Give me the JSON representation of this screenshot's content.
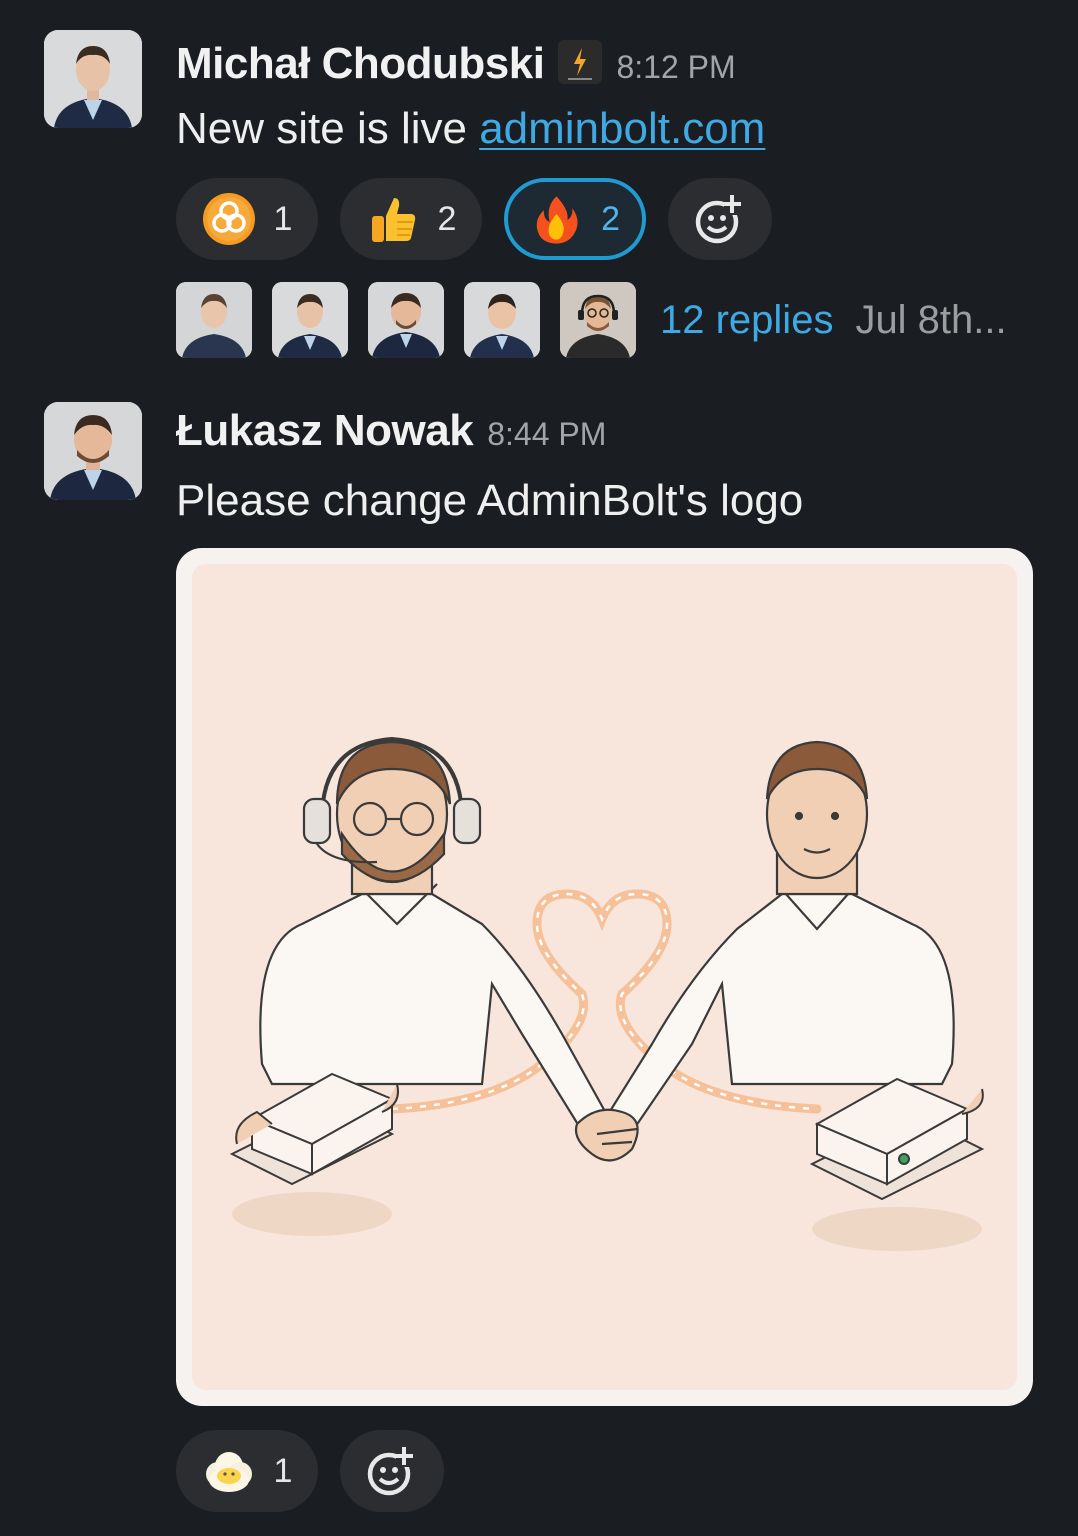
{
  "messages": [
    {
      "author": "Michał Chodubski",
      "time": "8:12 PM",
      "text_prefix": "New site is live ",
      "link_text": "adminbolt.com",
      "reactions": [
        {
          "icon": "biohazard-emoji-icon",
          "count": "1",
          "active": false
        },
        {
          "icon": "thumbs-up-emoji-icon",
          "count": "2",
          "active": false
        },
        {
          "icon": "fire-emoji-icon",
          "count": "2",
          "active": true
        }
      ],
      "thread": {
        "replies": "12 replies",
        "date": "Jul 8th..."
      }
    },
    {
      "author": "Łukasz Nowak",
      "time": "8:44 PM",
      "text": "Please change AdminBolt's logo",
      "image_alt": "illustration of two men shaking hands between servers with a heart-shaped cable",
      "reactions": [
        {
          "icon": "cloud-face-emoji-icon",
          "count": "1",
          "active": false
        }
      ]
    }
  ],
  "colors": {
    "background": "#1a1d21",
    "link": "#3fa9e3",
    "active_reaction_border": "#1f9bd1",
    "pill": "#2b2d31",
    "image_bg": "#f8e6dc",
    "cable": "#f08a3c"
  }
}
